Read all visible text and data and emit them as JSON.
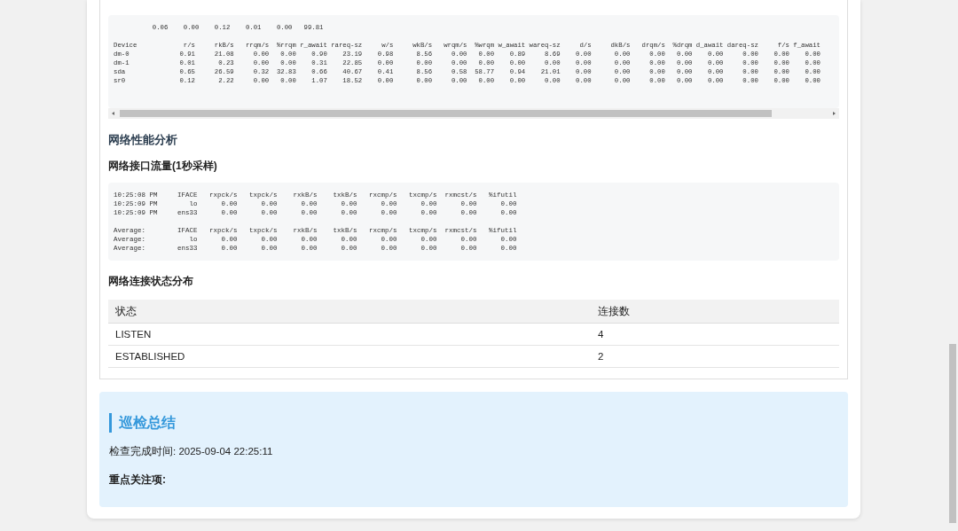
{
  "disk_stats": {
    "groups": [
      [
        "          0.06    0.00    0.12    0.01    0.00   99.81"
      ],
      [
        "Device            r/s     rkB/s   rrqm/s  %rrqm r_await rareq-sz     w/s     wkB/s   wrqm/s  %wrqm w_await wareq-sz     d/s     dkB/s   drqm/s  %drqm d_await dareq-sz     f/s f_await",
        "dm-0             0.91     21.08     0.00   0.00    0.90    23.19    0.98      8.56     0.00   0.00    0.89     8.69    0.00      0.00     0.00   0.00    0.00     0.00    0.00    0.00",
        "dm-1             0.01      0.23     0.00   0.00    0.31    22.85    0.00      0.00     0.00   0.00    0.00     0.00    0.00      0.00     0.00   0.00    0.00     0.00    0.00    0.00",
        "sda              0.65     26.59     0.32  32.83    0.66    40.67    0.41      8.56     0.58  58.77    0.94    21.01    0.00      0.00     0.00   0.00    0.00     0.00    0.00    0.00",
        "sr0              0.12      2.22     0.00   0.00    1.07    18.52    0.00      0.00     0.00   0.00    0.00     0.00    0.00      0.00     0.00   0.00    0.00     0.00    0.00    0.00"
      ]
    ]
  },
  "network_heading": "网络性能分析",
  "interface_heading": "网络接口流量(1秒采样)",
  "interface_stats": {
    "groups": [
      [
        "10:25:08 PM     IFACE   rxpck/s   txpck/s    rxkB/s    txkB/s   rxcmp/s   txcmp/s  rxmcst/s   %ifutil",
        "10:25:09 PM        lo      0.00      0.00      0.00      0.00      0.00      0.00      0.00      0.00",
        "10:25:09 PM     ens33      0.00      0.00      0.00      0.00      0.00      0.00      0.00      0.00"
      ],
      [
        "Average:        IFACE   rxpck/s   txpck/s    rxkB/s    txkB/s   rxcmp/s   txcmp/s  rxmcst/s   %ifutil",
        "Average:           lo      0.00      0.00      0.00      0.00      0.00      0.00      0.00      0.00",
        "Average:        ens33      0.00      0.00      0.00      0.00      0.00      0.00      0.00      0.00"
      ]
    ]
  },
  "connection_heading": "网络连接状态分布",
  "connection_table": {
    "columns": [
      "状态",
      "连接数"
    ],
    "rows": [
      [
        "LISTEN",
        "4"
      ],
      [
        "ESTABLISHED",
        "2"
      ]
    ]
  },
  "summary": {
    "title": "巡检总结",
    "completed": "检查完成时间: 2025-09-04 22:25:11",
    "focus_heading": "重点关注项:"
  }
}
